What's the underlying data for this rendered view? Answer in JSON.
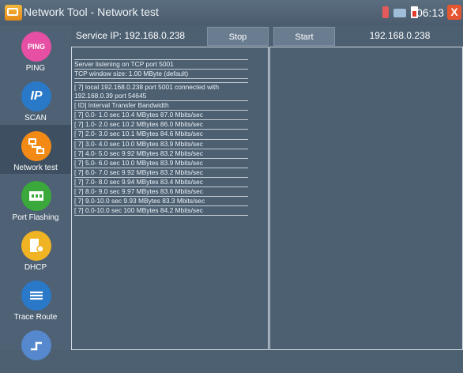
{
  "titlebar": {
    "title": "Network Tool - Network test",
    "time": "06:13",
    "close_label": "X"
  },
  "sidebar": {
    "items": [
      {
        "label": "PING",
        "icon_text": "PING"
      },
      {
        "label": "SCAN",
        "icon_text": "IP"
      },
      {
        "label": "Network test",
        "icon_text": ""
      },
      {
        "label": "Port Flashing",
        "icon_text": ""
      },
      {
        "label": "DHCP",
        "icon_text": ""
      },
      {
        "label": "Trace Route",
        "icon_text": ""
      },
      {
        "label": "",
        "icon_text": ""
      }
    ]
  },
  "main": {
    "service_ip": "Service IP: 192.168.0.238",
    "stop_label": "Stop",
    "start_label": "Start",
    "target_ip": "192.168.0.238",
    "log_lines": [
      "Server listening on TCP port 5001",
      "TCP window size: 1.00 MByte (default)",
      "[ 7] local 192.168.0.238 port 5001 connected with 192.168.0.39 port 54645",
      "[ ID] Interval     Transfer     Bandwidth",
      "[ 7] 0.0- 1.0 sec  10.4 MBytes  87.0 Mbits/sec",
      "[ 7] 1.0- 2.0 sec  10.2 MBytes  86.0 Mbits/sec",
      "[ 7] 2.0- 3.0 sec  10.1 MBytes  84.6 Mbits/sec",
      "[ 7] 3.0- 4.0 sec  10.0 MBytes  83.9 Mbits/sec",
      "[ 7] 4.0- 5.0 sec  9.92 MBytes  83.2 Mbits/sec",
      "[ 7] 5.0- 6.0 sec  10.0 MBytes  83.9 Mbits/sec",
      "[ 7] 6.0- 7.0 sec  9.92 MBytes  83.2 Mbits/sec",
      "[ 7] 7.0- 8.0 sec  9.94 MBytes  83.4 Mbits/sec",
      "[ 7] 8.0- 9.0 sec  9.97 MBytes  83.6 Mbits/sec",
      "[ 7] 9.0-10.0 sec  9.93 MBytes  83.3 Mbits/sec",
      "[ 7] 0.0-10.0 sec  100 MBytes  84.2 Mbits/sec"
    ]
  }
}
